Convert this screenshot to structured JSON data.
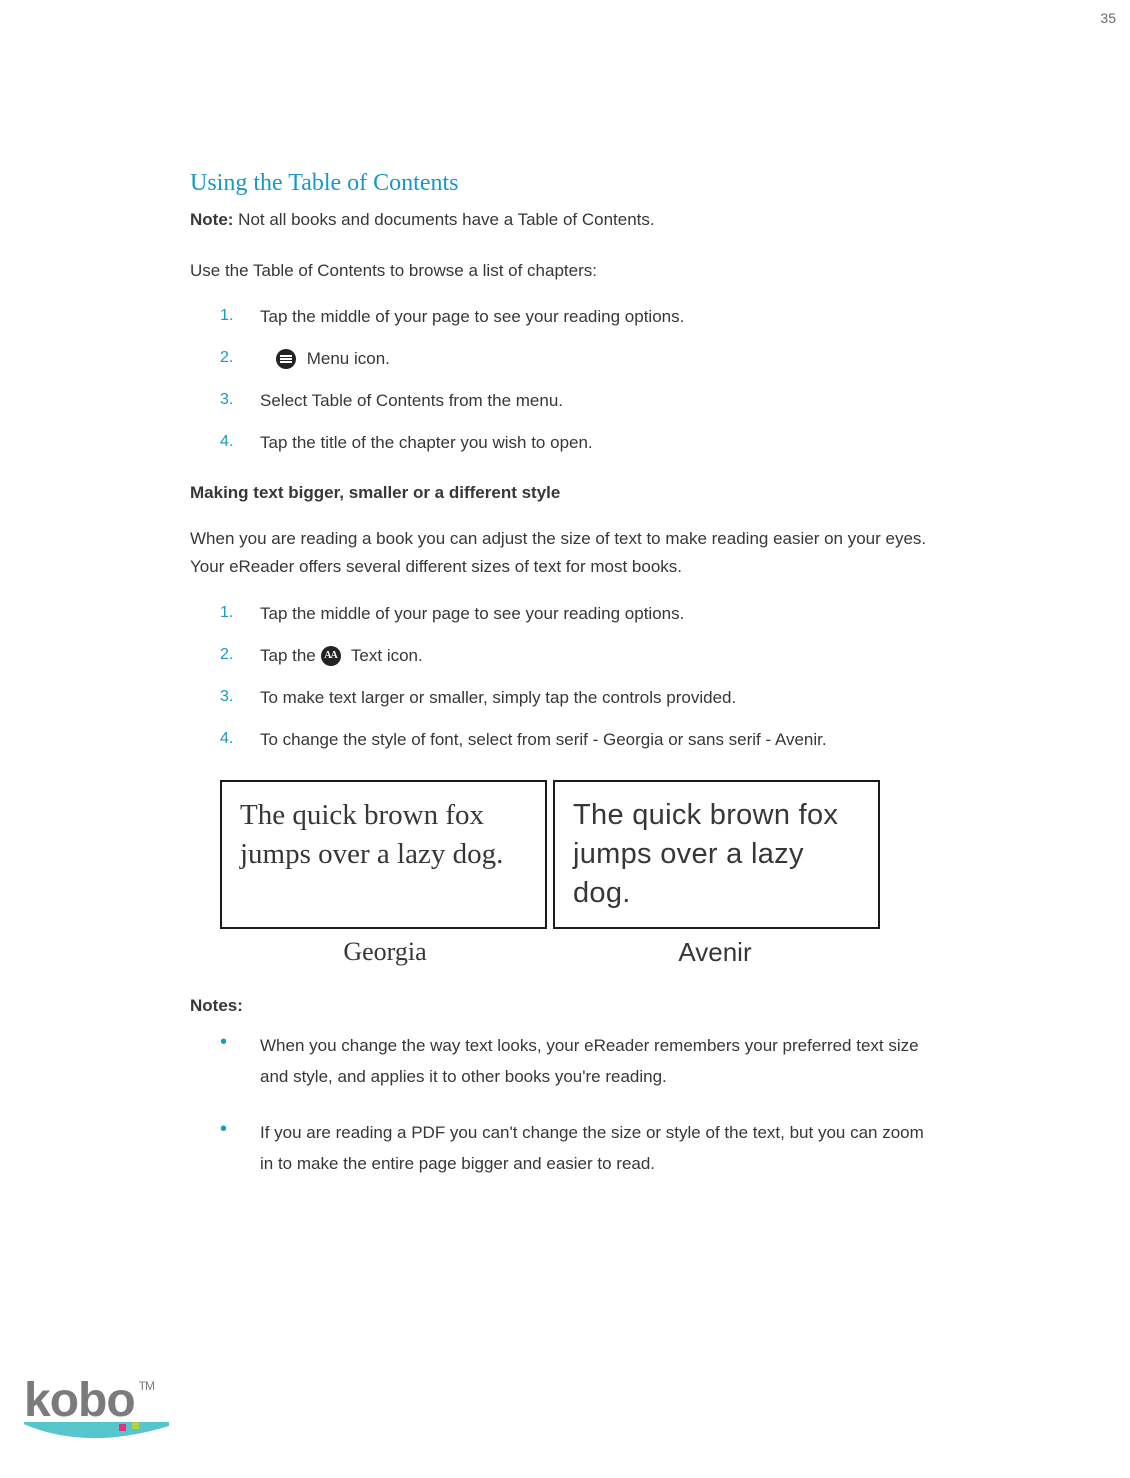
{
  "page_number": "35",
  "section_title": "Using the Table of Contents",
  "note_label": "Note:",
  "note_text": " Not all books and documents have a Table of Contents.",
  "intro1": "Use the Table of Contents to browse a list of chapters:",
  "steps1": [
    "Tap the middle of your page to see your reading options.",
    " Menu icon.",
    "Select Table of Contents from the menu.",
    "Tap the title of the chapter you wish to open."
  ],
  "subheading": "Making text bigger, smaller or a different style",
  "intro2": "When you are reading a book you can adjust the size of text to make reading easier on your eyes. Your eReader offers several different sizes of text for most books.",
  "steps2": [
    "Tap the middle of your page to see your reading options.",
    {
      "pre": "Tap the ",
      "post": " Text icon."
    },
    "To make text larger or smaller, simply tap the controls provided.",
    "To change the style of font, select from serif  - Georgia or sans serif - Avenir."
  ],
  "sample_text": "The quick brown fox jumps over a lazy dog.",
  "font_labels": {
    "serif": "Georgia",
    "sans": "Avenir"
  },
  "notes_heading": "Notes:",
  "notes": [
    "When you change the way text looks, your eReader remembers your preferred text size and style, and applies it to other books you're reading.",
    "If you are reading a PDF you can't change the size or style of the text, but you can zoom in to make the entire page bigger and easier to read."
  ],
  "brand": "kobo",
  "tm": "TM"
}
